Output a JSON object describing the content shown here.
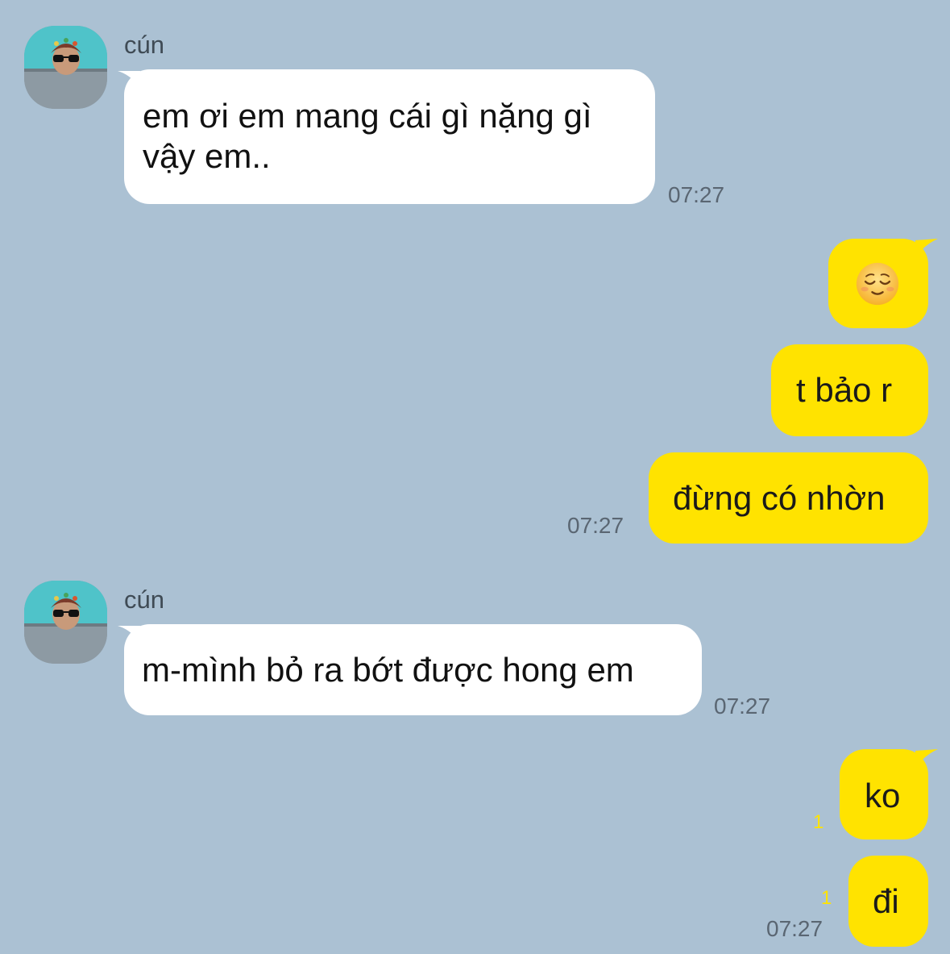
{
  "contact": {
    "name": "cún"
  },
  "messages": [
    {
      "id": "m1",
      "direction": "incoming",
      "text": "em ơi em mang cái gì nặng gì vậy em..",
      "time": "07:27"
    },
    {
      "id": "m2",
      "direction": "outgoing",
      "emoji": "relieved-face-emoji"
    },
    {
      "id": "m3",
      "direction": "outgoing",
      "text": "t bảo r"
    },
    {
      "id": "m4",
      "direction": "outgoing",
      "text": "đừng có nhờn",
      "time": "07:27"
    },
    {
      "id": "m5",
      "direction": "incoming",
      "text": "m-mình bỏ ra bớt được hong em",
      "time": "07:27"
    },
    {
      "id": "m6",
      "direction": "outgoing",
      "text": "ko",
      "unread": "1"
    },
    {
      "id": "m7",
      "direction": "outgoing",
      "text": "đi",
      "unread": "1",
      "time": "07:27"
    }
  ],
  "colors": {
    "background": "#abc1d3",
    "incoming_bubble": "#ffffff",
    "outgoing_bubble": "#ffe300",
    "unread_count": "#ffe300"
  }
}
